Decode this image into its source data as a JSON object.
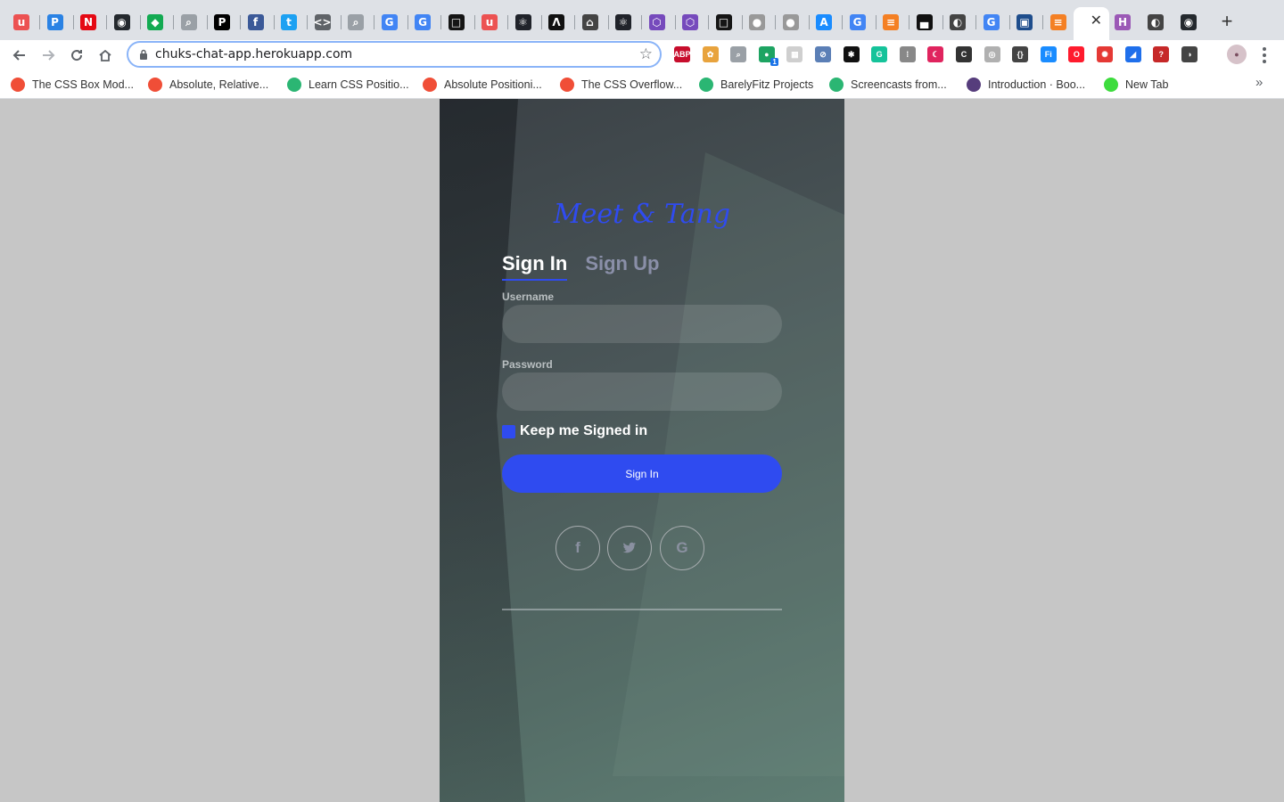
{
  "browser": {
    "tabs": [
      {
        "icon": "udemy-icon",
        "glyph": "u",
        "color": "#ec5252"
      },
      {
        "icon": "pluralsight-icon",
        "glyph": "P",
        "color": "#2a82e4"
      },
      {
        "icon": "netflix-icon",
        "glyph": "N",
        "color": "#e50914"
      },
      {
        "icon": "github-icon",
        "glyph": "◉",
        "color": "#24292e"
      },
      {
        "icon": "mongodb-icon",
        "glyph": "◆",
        "color": "#13aa52"
      },
      {
        "icon": "search-icon",
        "glyph": "⌕",
        "color": "#9aa0a6"
      },
      {
        "icon": "pycharm-icon",
        "glyph": "P",
        "color": "#000000"
      },
      {
        "icon": "facebook-icon",
        "glyph": "f",
        "color": "#3b5998"
      },
      {
        "icon": "twitter-icon",
        "glyph": "t",
        "color": "#1da1f2"
      },
      {
        "icon": "code-icon",
        "glyph": "<>",
        "color": "#5f6368"
      },
      {
        "icon": "search-icon",
        "glyph": "⌕",
        "color": "#9aa0a6"
      },
      {
        "icon": "google-icon",
        "glyph": "G",
        "color": "#4285f4"
      },
      {
        "icon": "google-icon",
        "glyph": "G",
        "color": "#4285f4"
      },
      {
        "icon": "codesandbox-icon",
        "glyph": "□",
        "color": "#151515"
      },
      {
        "icon": "udemy-icon",
        "glyph": "u",
        "color": "#ec5252"
      },
      {
        "icon": "react-icon",
        "glyph": "⚛",
        "color": "#20232a"
      },
      {
        "icon": "arch-icon",
        "glyph": "Λ",
        "color": "#111111"
      },
      {
        "icon": "graduation-icon",
        "glyph": "⌂",
        "color": "#444444"
      },
      {
        "icon": "react-icon",
        "glyph": "⚛",
        "color": "#20232a"
      },
      {
        "icon": "redux-icon",
        "glyph": "⬡",
        "color": "#764abc"
      },
      {
        "icon": "redux-icon",
        "glyph": "⬡",
        "color": "#764abc"
      },
      {
        "icon": "codesandbox-icon",
        "glyph": "□",
        "color": "#151515"
      },
      {
        "icon": "apple-icon",
        "glyph": "●",
        "color": "#999999"
      },
      {
        "icon": "apple-icon",
        "glyph": "●",
        "color": "#999999"
      },
      {
        "icon": "appstore-icon",
        "glyph": "A",
        "color": "#1a8cff"
      },
      {
        "icon": "google-icon",
        "glyph": "G",
        "color": "#4285f4"
      },
      {
        "icon": "stackoverflow-icon",
        "glyph": "≡",
        "color": "#f48024"
      },
      {
        "icon": "unsplash-icon",
        "glyph": "▄",
        "color": "#111111"
      },
      {
        "icon": "globe-icon",
        "glyph": "◐",
        "color": "#444444"
      },
      {
        "icon": "google-icon",
        "glyph": "G",
        "color": "#4285f4"
      },
      {
        "icon": "visualstudio-icon",
        "glyph": "▣",
        "color": "#1e4d8c"
      },
      {
        "icon": "stackoverflow-icon",
        "glyph": "≡",
        "color": "#f48024"
      }
    ],
    "tabs_right": [
      {
        "icon": "hashnode-icon",
        "glyph": "H",
        "color": "#9b59b6"
      },
      {
        "icon": "globe-icon",
        "glyph": "◐",
        "color": "#444444"
      },
      {
        "icon": "github-icon",
        "glyph": "◉",
        "color": "#24292e"
      }
    ],
    "active_tab_close": "✕",
    "new_tab": "+",
    "url": "chuks-chat-app.herokuapp.com",
    "extensions": [
      {
        "name": "adblock-plus-icon",
        "glyph": "ABP",
        "color": "#c70d2c"
      },
      {
        "name": "colorpick-icon",
        "glyph": "✿",
        "color": "#e8a33d"
      },
      {
        "name": "zoom-icon",
        "glyph": "⌕",
        "color": "#9aa0a6"
      },
      {
        "name": "green-dot-icon",
        "glyph": "●",
        "color": "#1da462"
      },
      {
        "name": "grid-icon",
        "glyph": "▦",
        "color": "#cfcfcf"
      },
      {
        "name": "compass-icon",
        "glyph": "⊘",
        "color": "#5b7fb6"
      },
      {
        "name": "colorzilla-icon",
        "glyph": "✱",
        "color": "#111111"
      },
      {
        "name": "grammarly-icon",
        "glyph": "G",
        "color": "#15c39a"
      },
      {
        "name": "bars-icon",
        "glyph": "⁞",
        "color": "#888888"
      },
      {
        "name": "moon-icon",
        "glyph": "☾",
        "color": "#e0245e"
      },
      {
        "name": "cssc-icon",
        "glyph": "C",
        "color": "#333333"
      },
      {
        "name": "eye-icon",
        "glyph": "◎",
        "color": "#b0b0b0"
      },
      {
        "name": "braces-icon",
        "glyph": "{}",
        "color": "#444444"
      },
      {
        "name": "font-icon",
        "glyph": "Fi",
        "color": "#1a8cff"
      },
      {
        "name": "opera-icon",
        "glyph": "O",
        "color": "#ff1b2d"
      },
      {
        "name": "colorwheel-icon",
        "glyph": "✺",
        "color": "#e53935"
      },
      {
        "name": "megaphone-icon",
        "glyph": "◢",
        "color": "#1f6feb"
      },
      {
        "name": "question-icon",
        "glyph": "?",
        "color": "#c62828"
      },
      {
        "name": "dark-reader-icon",
        "glyph": "◑",
        "color": "#444444"
      }
    ],
    "extension_badge": "1"
  },
  "bookmarks": [
    {
      "label": "The CSS Box Mod...",
      "icon": "codepen-star-icon",
      "color": "#f04e37"
    },
    {
      "label": "Absolute, Relative...",
      "icon": "codepen-star-icon",
      "color": "#f04e37"
    },
    {
      "label": "Learn CSS Positio...",
      "icon": "scrimba-icon",
      "color": "#2bb673"
    },
    {
      "label": "Absolute Positioni...",
      "icon": "codepen-star-icon",
      "color": "#f04e37"
    },
    {
      "label": "The CSS Overflow...",
      "icon": "codepen-star-icon",
      "color": "#f04e37"
    },
    {
      "label": "BarelyFitz Projects",
      "icon": "scrimba-icon",
      "color": "#2bb673"
    },
    {
      "label": "Screencasts from...",
      "icon": "scrimba-icon",
      "color": "#2bb673"
    },
    {
      "label": "Introduction · Boo...",
      "icon": "bootstrap-icon",
      "color": "#563d7c"
    },
    {
      "label": "New Tab",
      "icon": "newtab-icon",
      "color": "#3ddc3d"
    }
  ],
  "bookmarks_more": "»",
  "app": {
    "brand": "Meet & Tang",
    "tabs": {
      "signin": "Sign In",
      "signup": "Sign Up"
    },
    "username_label": "Username",
    "password_label": "Password",
    "keep_signed_in": "Keep me Signed in",
    "signin_button": "Sign In",
    "social": {
      "facebook": "f",
      "twitter": "t",
      "google": "G"
    },
    "colors": {
      "accent": "#2f4bf0"
    }
  }
}
